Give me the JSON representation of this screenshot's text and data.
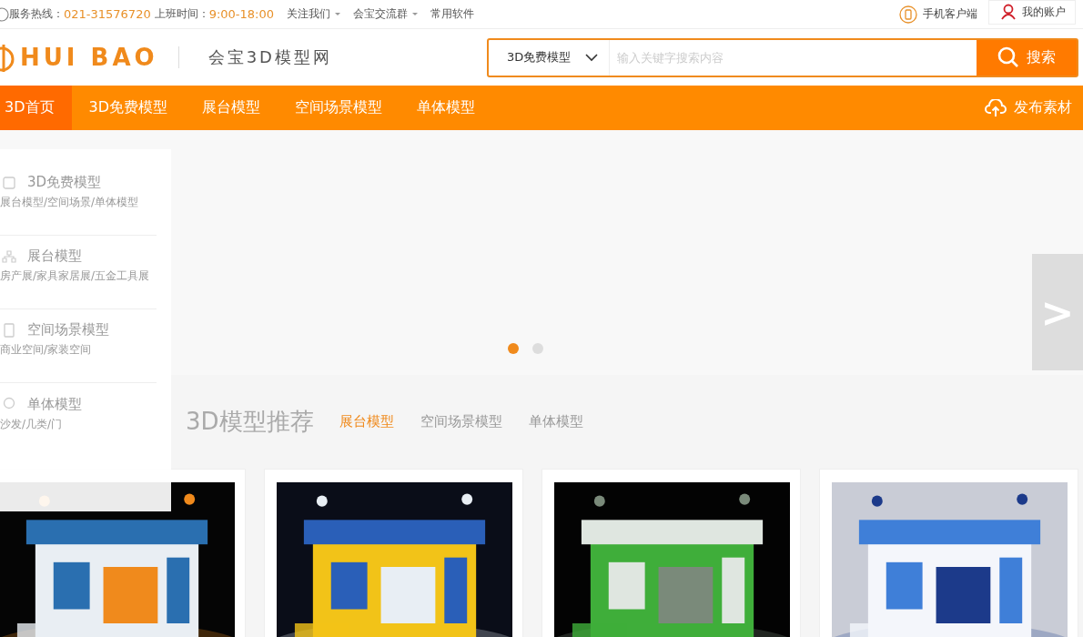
{
  "topbar": {
    "hotline_label": "服务热线：",
    "hotline": "021-31576720",
    "hours_label": "上班时间：",
    "hours": "9:00-18:00",
    "links": [
      {
        "label": "关注我们",
        "dropdown": true
      },
      {
        "label": "会宝交流群",
        "dropdown": true
      },
      {
        "label": "常用软件",
        "dropdown": false
      }
    ],
    "app_link": "手机客户端",
    "account": "我的账户"
  },
  "header": {
    "logo": "HUI BAO",
    "site_name": "会宝3D模型网",
    "search": {
      "category": "3D免费模型",
      "placeholder": "输入关键字搜索内容",
      "button": "搜索"
    }
  },
  "nav": {
    "items": [
      {
        "label": "3D首页",
        "selected": true
      },
      {
        "label": "3D免费模型",
        "selected": false
      },
      {
        "label": "展台模型",
        "selected": false
      },
      {
        "label": "空间场景模型",
        "selected": false
      },
      {
        "label": "单体模型",
        "selected": false
      }
    ],
    "publish": "发布素材"
  },
  "sidebar": {
    "items": [
      {
        "title": "3D免费模型",
        "subtitle": "展台模型/空间场景/单体模型"
      },
      {
        "title": "展台模型",
        "subtitle": "房产展/家具家居展/五金工具展"
      },
      {
        "title": "空间场景模型",
        "subtitle": "商业空间/家装空间"
      },
      {
        "title": "单体模型",
        "subtitle": "沙发/几类/门"
      }
    ]
  },
  "carousel": {
    "dots": [
      {
        "selected": true
      },
      {
        "selected": false
      }
    ],
    "next_arrow": ">"
  },
  "section": {
    "title": "3D模型推荐",
    "tabs": [
      {
        "label": "展台模型",
        "selected": true
      },
      {
        "label": "空间场景模型",
        "selected": false
      },
      {
        "label": "单体模型",
        "selected": false
      }
    ]
  }
}
